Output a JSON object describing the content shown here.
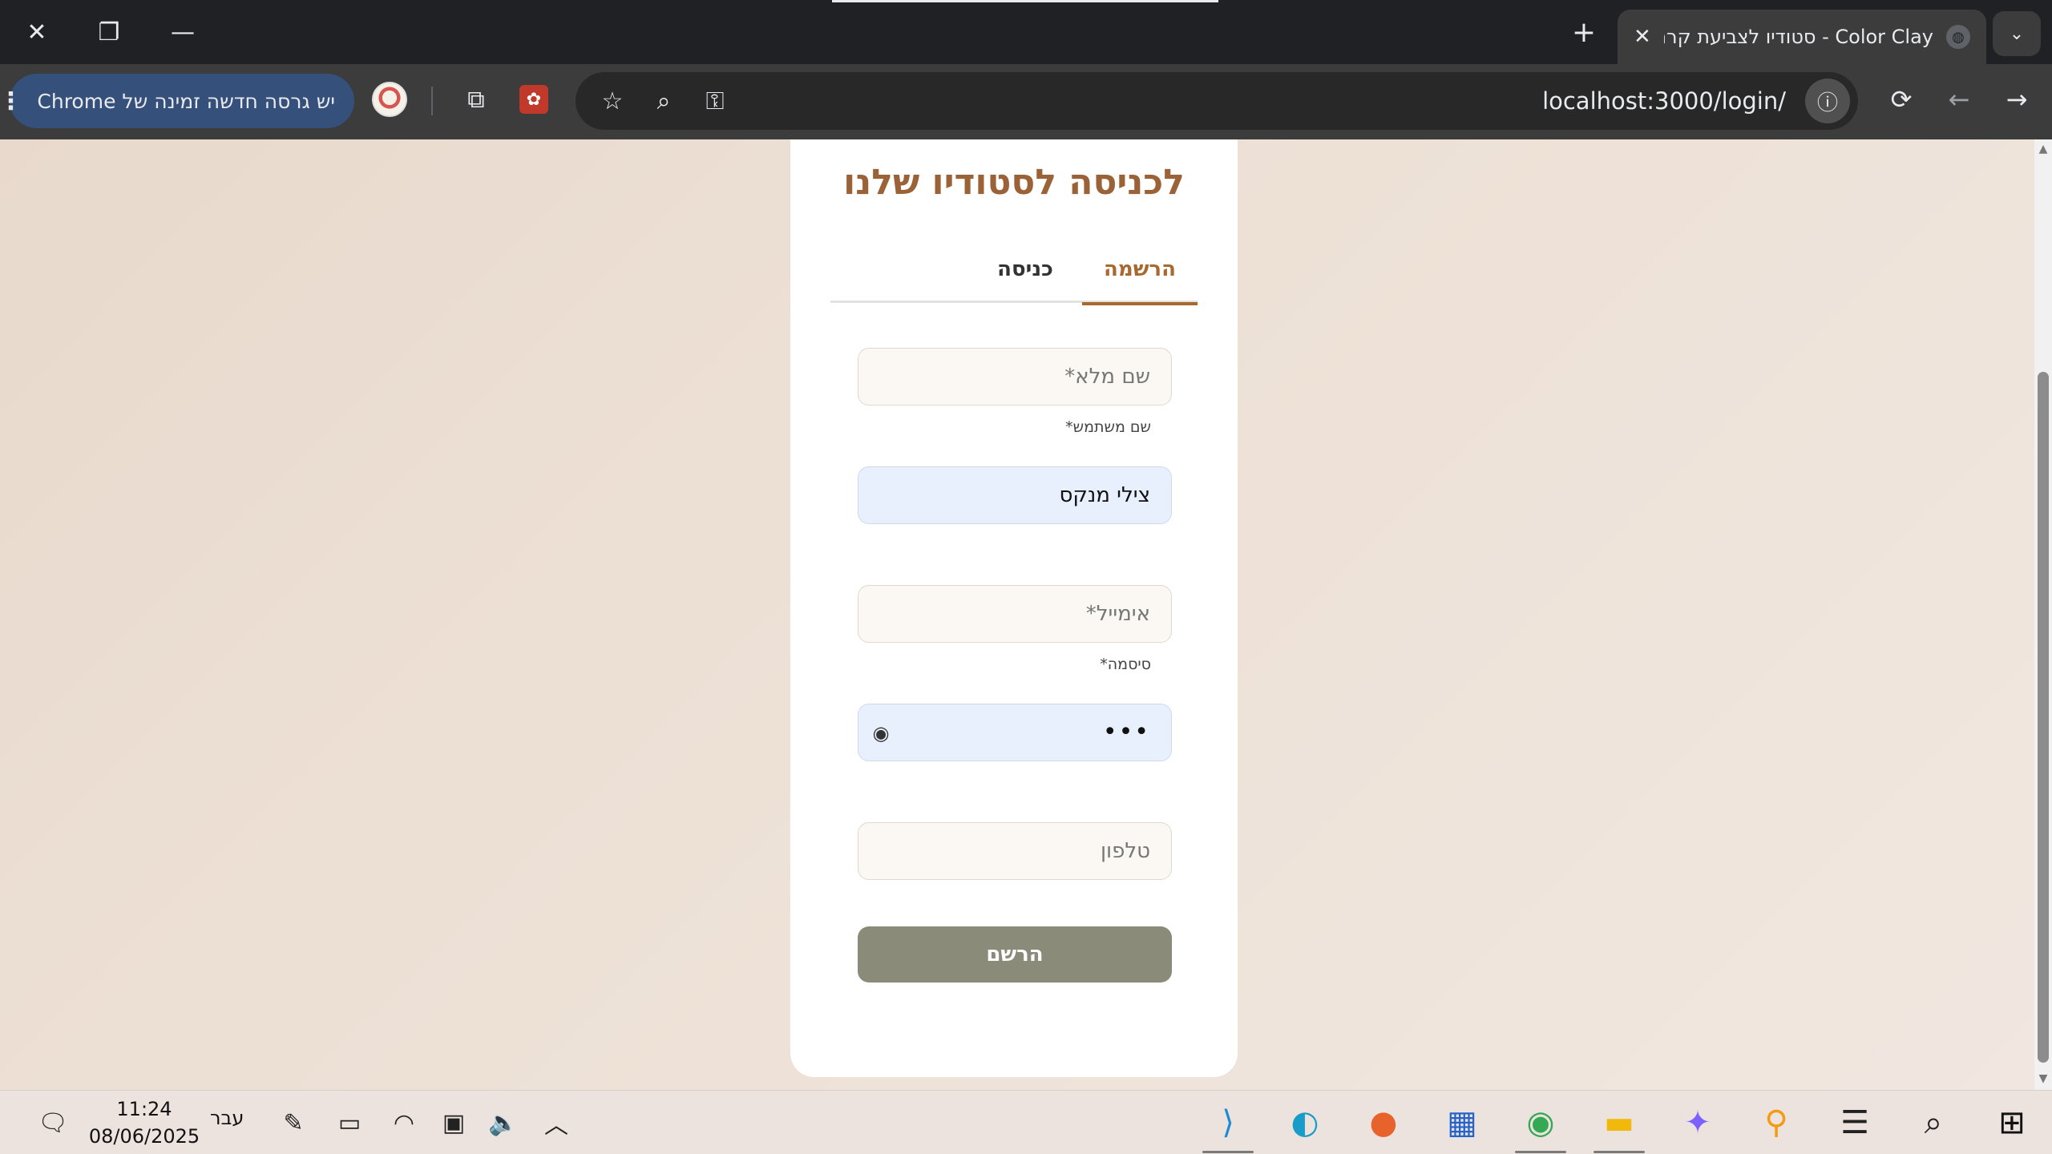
{
  "browser": {
    "tab_title": "Color Clay - סטודיו לצביעת קרמיקה",
    "url": "localhost:3000/login/",
    "update_text": "יש גרסה חדשה זמינה של Chrome",
    "glyphs": {
      "close": "✕",
      "restore": "❐",
      "minimize": "—",
      "new_tab": "+",
      "tab_list": "⌄",
      "tab_close": "✕",
      "back": "←",
      "forward": "→",
      "reload": "⟳",
      "info": "ⓘ",
      "star": "☆",
      "zoom": "⌕",
      "key": "⚿",
      "extensions": "⧉",
      "menu_dots": "⋮"
    }
  },
  "page": {
    "heading": "לכניסה לסטודיו שלנו",
    "tabs": [
      {
        "label": "הרשמה",
        "active": true
      },
      {
        "label": "כניסה",
        "active": false
      }
    ],
    "fields": {
      "full_name_placeholder": "שם מלא*",
      "username_label": "שם משתמש*",
      "username_value": "צילי מנקס",
      "email_placeholder": "אימייל*",
      "password_label": "סיסמה*",
      "password_value": "•••",
      "phone_placeholder": "טלפון"
    },
    "submit_label": "הרשם",
    "colors": {
      "accent": "#a8692f",
      "heading": "#9a6236",
      "button": "#8b8b7a",
      "autofill": "#e8f0fe"
    }
  },
  "taskbar": {
    "time": "11:24",
    "date": "08/06/2025",
    "language": "עבר",
    "apps": [
      "vscode-icon",
      "edge-icon",
      "firefox-icon",
      "store-icon",
      "chrome-icon",
      "file-explorer-icon",
      "copilot-icon",
      "search-app-icon",
      "task-view-icon",
      "search-icon",
      "start-icon"
    ]
  }
}
